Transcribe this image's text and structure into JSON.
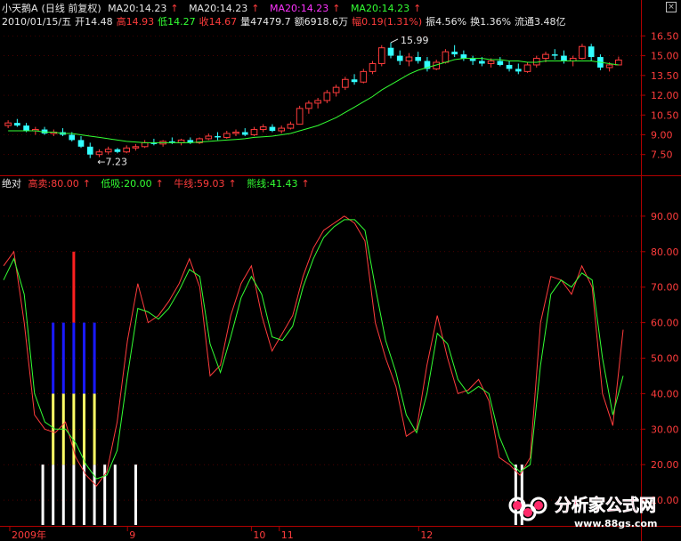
{
  "header": {
    "stock_name": "小天鹅A",
    "period": "(日线 前复权)",
    "ma_items": [
      {
        "label": "MA20:14.23",
        "color": "#e6e6e6"
      },
      {
        "label": "MA20:14.23",
        "color": "#e6e6e6"
      },
      {
        "label": "MA20:14.23",
        "color": "#ff33ff"
      },
      {
        "label": "MA20:14.23",
        "color": "#33ff33"
      }
    ],
    "quote": {
      "date": "2010/01/15/五",
      "open": "开14.48",
      "high": "高14.93",
      "low": "低14.27",
      "close": "收14.67",
      "volume": "量47479.7",
      "amount": "额6918.6万",
      "change": "幅0.19(1.31%)",
      "amplitude": "振4.56%",
      "turnover": "换1.36%",
      "float_cap": "流通3.48亿"
    }
  },
  "indicator_header": {
    "name": "绝对",
    "items": [
      {
        "label": "高卖:80.00",
        "color": "#ff3c3c"
      },
      {
        "label": "低吸:20.00",
        "color": "#33ff33"
      },
      {
        "label": "牛线:59.03",
        "color": "#ff3c3c"
      },
      {
        "label": "熊线:41.43",
        "color": "#33ff33"
      }
    ]
  },
  "price_annotations": {
    "high_mark": "15.99",
    "low_mark": "7.23"
  },
  "x_axis_labels": [
    {
      "label": "2009年",
      "pos": 0.01
    },
    {
      "label": "9",
      "pos": 0.2
    },
    {
      "label": "10",
      "pos": 0.4
    },
    {
      "label": "11",
      "pos": 0.445
    },
    {
      "label": "12",
      "pos": 0.67
    }
  ],
  "logo": {
    "title": "分析家公式网",
    "url": "www.88gs.com"
  },
  "colors": {
    "up": "#ff3c3c",
    "down": "#33ffff",
    "ma": "#33ff33",
    "bull": "#ff3c3c",
    "bear": "#33ff33",
    "grid": "#7a0000",
    "bar_white": "#ffffff",
    "bar_yellow": "#ffff66",
    "bar_blue": "#1a1aff",
    "bar_red": "#ff2020"
  },
  "chart_data": [
    {
      "type": "candlestick",
      "title": "小天鹅A",
      "y_ticks": [
        "16.50",
        "15.00",
        "13.50",
        "12.00",
        "10.50",
        "9.00",
        "7.50"
      ],
      "ylim": [
        6.4,
        17.2
      ],
      "ohlc": [
        [
          9.7,
          10.1,
          9.5,
          9.9
        ],
        [
          9.9,
          10.2,
          9.6,
          9.7
        ],
        [
          9.7,
          9.9,
          9.2,
          9.3
        ],
        [
          9.3,
          9.6,
          9.0,
          9.4
        ],
        [
          9.4,
          9.6,
          9.0,
          9.1
        ],
        [
          9.1,
          9.4,
          8.9,
          9.2
        ],
        [
          9.2,
          9.5,
          8.9,
          9.0
        ],
        [
          9.0,
          9.2,
          8.5,
          8.6
        ],
        [
          8.6,
          8.9,
          8.0,
          8.1
        ],
        [
          8.1,
          8.4,
          7.23,
          7.5
        ],
        [
          7.5,
          7.9,
          7.3,
          7.7
        ],
        [
          7.7,
          8.1,
          7.5,
          7.9
        ],
        [
          7.9,
          8.0,
          7.6,
          7.7
        ],
        [
          7.7,
          8.2,
          7.6,
          8.0
        ],
        [
          8.0,
          8.3,
          7.8,
          8.1
        ],
        [
          8.1,
          8.6,
          8.0,
          8.4
        ],
        [
          8.4,
          8.7,
          8.2,
          8.3
        ],
        [
          8.3,
          8.6,
          8.1,
          8.5
        ],
        [
          8.5,
          8.8,
          8.3,
          8.4
        ],
        [
          8.4,
          8.7,
          8.2,
          8.6
        ],
        [
          8.6,
          8.8,
          8.3,
          8.4
        ],
        [
          8.4,
          8.8,
          8.3,
          8.7
        ],
        [
          8.7,
          9.1,
          8.6,
          8.9
        ],
        [
          8.9,
          9.2,
          8.6,
          8.8
        ],
        [
          8.8,
          9.3,
          8.7,
          9.1
        ],
        [
          9.1,
          9.4,
          8.9,
          9.2
        ],
        [
          9.2,
          9.5,
          8.9,
          9.0
        ],
        [
          9.0,
          9.6,
          8.9,
          9.4
        ],
        [
          9.4,
          9.8,
          9.2,
          9.6
        ],
        [
          9.6,
          9.8,
          9.2,
          9.3
        ],
        [
          9.3,
          9.7,
          9.1,
          9.5
        ],
        [
          9.5,
          10.0,
          9.4,
          9.8
        ],
        [
          9.8,
          11.2,
          9.8,
          11.0
        ],
        [
          11.0,
          11.6,
          10.6,
          11.4
        ],
        [
          11.4,
          11.8,
          11.0,
          11.6
        ],
        [
          11.6,
          12.4,
          11.4,
          12.2
        ],
        [
          12.2,
          12.8,
          11.9,
          12.6
        ],
        [
          12.6,
          13.4,
          12.4,
          13.2
        ],
        [
          13.2,
          13.6,
          12.8,
          13.0
        ],
        [
          13.0,
          14.0,
          12.9,
          13.8
        ],
        [
          13.8,
          14.6,
          13.6,
          14.4
        ],
        [
          14.4,
          15.8,
          14.2,
          15.6
        ],
        [
          15.6,
          15.99,
          14.8,
          15.0
        ],
        [
          15.0,
          15.4,
          14.3,
          14.6
        ],
        [
          14.6,
          15.2,
          14.2,
          14.9
        ],
        [
          14.9,
          15.3,
          14.4,
          14.6
        ],
        [
          14.6,
          14.9,
          13.8,
          14.0
        ],
        [
          14.0,
          14.7,
          13.9,
          14.5
        ],
        [
          14.5,
          15.5,
          14.4,
          15.3
        ],
        [
          15.3,
          15.8,
          14.9,
          15.1
        ],
        [
          15.1,
          15.4,
          14.6,
          14.8
        ],
        [
          14.8,
          15.0,
          14.3,
          14.6
        ],
        [
          14.6,
          14.9,
          14.2,
          14.4
        ],
        [
          14.4,
          14.8,
          14.1,
          14.6
        ],
        [
          14.6,
          14.9,
          14.2,
          14.3
        ],
        [
          14.3,
          14.6,
          13.8,
          14.0
        ],
        [
          14.0,
          14.4,
          13.6,
          13.8
        ],
        [
          13.8,
          14.5,
          13.7,
          14.3
        ],
        [
          14.3,
          15.0,
          14.1,
          14.8
        ],
        [
          14.8,
          15.3,
          14.5,
          15.1
        ],
        [
          15.1,
          15.5,
          14.7,
          15.0
        ],
        [
          15.0,
          15.4,
          14.4,
          14.6
        ],
        [
          14.6,
          15.0,
          14.2,
          14.8
        ],
        [
          14.8,
          15.9,
          14.7,
          15.7
        ],
        [
          15.7,
          15.9,
          14.6,
          14.9
        ],
        [
          14.9,
          15.1,
          13.9,
          14.1
        ],
        [
          14.1,
          14.5,
          13.8,
          14.3
        ],
        [
          14.3,
          14.93,
          14.27,
          14.67
        ]
      ],
      "ma20": [
        9.3,
        9.3,
        9.3,
        9.3,
        9.2,
        9.2,
        9.1,
        9.1,
        9.0,
        8.9,
        8.8,
        8.7,
        8.6,
        8.5,
        8.45,
        8.4,
        8.4,
        8.4,
        8.4,
        8.4,
        8.4,
        8.45,
        8.5,
        8.55,
        8.6,
        8.65,
        8.7,
        8.8,
        8.85,
        8.9,
        9.0,
        9.1,
        9.3,
        9.5,
        9.7,
        10.0,
        10.3,
        10.7,
        11.1,
        11.5,
        11.9,
        12.4,
        12.8,
        13.2,
        13.6,
        13.9,
        14.1,
        14.3,
        14.5,
        14.7,
        14.8,
        14.8,
        14.8,
        14.7,
        14.7,
        14.6,
        14.6,
        14.5,
        14.5,
        14.6,
        14.6,
        14.6,
        14.6,
        14.6,
        14.6,
        14.5,
        14.4,
        14.3
      ]
    },
    {
      "type": "line",
      "title": "绝对",
      "y_ticks": [
        "90.00",
        "80.00",
        "70.00",
        "60.00",
        "50.00",
        "40.00",
        "30.00",
        "20.00",
        "10.00"
      ],
      "ylim": [
        3,
        97
      ],
      "series": [
        {
          "name": "牛线",
          "values": [
            76,
            80,
            60,
            34,
            30,
            29,
            32,
            22,
            17,
            14,
            18,
            32,
            55,
            71,
            60,
            62,
            66,
            71,
            78,
            70,
            45,
            48,
            62,
            71,
            76,
            62,
            52,
            57,
            62,
            73,
            81,
            86,
            88,
            90,
            88,
            83,
            60,
            50,
            42,
            28,
            30,
            48,
            62,
            50,
            40,
            41,
            44,
            38,
            22,
            20,
            17,
            22,
            60,
            73,
            72,
            68,
            76,
            70,
            40,
            31,
            58
          ],
          "labels": []
        },
        {
          "name": "熊线",
          "values": [
            72,
            78,
            68,
            40,
            32,
            30,
            30,
            26,
            20,
            16,
            17,
            24,
            45,
            64,
            63,
            61,
            64,
            69,
            75,
            73,
            54,
            46,
            56,
            67,
            73,
            68,
            56,
            55,
            59,
            70,
            78,
            84,
            87,
            89,
            89,
            86,
            70,
            55,
            46,
            34,
            29,
            40,
            57,
            54,
            44,
            40,
            42,
            40,
            28,
            21,
            18,
            20,
            48,
            68,
            72,
            70,
            74,
            72,
            50,
            34,
            45
          ]
        }
      ]
    }
  ]
}
